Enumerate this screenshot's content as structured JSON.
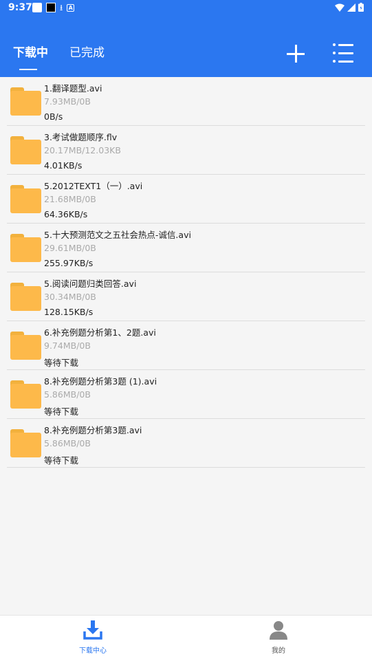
{
  "status_bar": {
    "time": "9:37"
  },
  "tabs": [
    {
      "label": "下载中",
      "active": true
    },
    {
      "label": "已完成",
      "active": false
    }
  ],
  "toolbar": {
    "add_icon": "plus-icon",
    "menu_icon": "list-icon"
  },
  "downloads": [
    {
      "name": "1.翻译题型.avi",
      "size": "7.93MB/0B",
      "status": "0B/s"
    },
    {
      "name": "3.考试做题顺序.flv",
      "size": "20.17MB/12.03KB",
      "status": "4.01KB/s"
    },
    {
      "name": "5.2012TEXT1（一）.avi",
      "size": "21.68MB/0B",
      "status": "64.36KB/s"
    },
    {
      "name": "5.十大预测范文之五社会热点-诚信.avi",
      "size": "29.61MB/0B",
      "status": "255.97KB/s"
    },
    {
      "name": "5.阅读问题归类回答.avi",
      "size": "30.34MB/0B",
      "status": "128.15KB/s"
    },
    {
      "name": "6.补充例题分析第1、2题.avi",
      "size": "9.74MB/0B",
      "status": "等待下载"
    },
    {
      "name": "8.补充例题分析第3题 (1).avi",
      "size": "5.86MB/0B",
      "status": "等待下载"
    },
    {
      "name": "8.补充例题分析第3题.avi",
      "size": "5.86MB/0B",
      "status": "等待下载"
    }
  ],
  "bottom_nav": [
    {
      "label": "下载中心",
      "icon": "download-icon",
      "active": true
    },
    {
      "label": "我的",
      "icon": "user-icon",
      "active": false
    }
  ],
  "colors": {
    "primary": "#2b77f0",
    "folder": "#fdb94a",
    "secondary_text": "#aaaaaa",
    "inactive_nav": "#888888"
  }
}
